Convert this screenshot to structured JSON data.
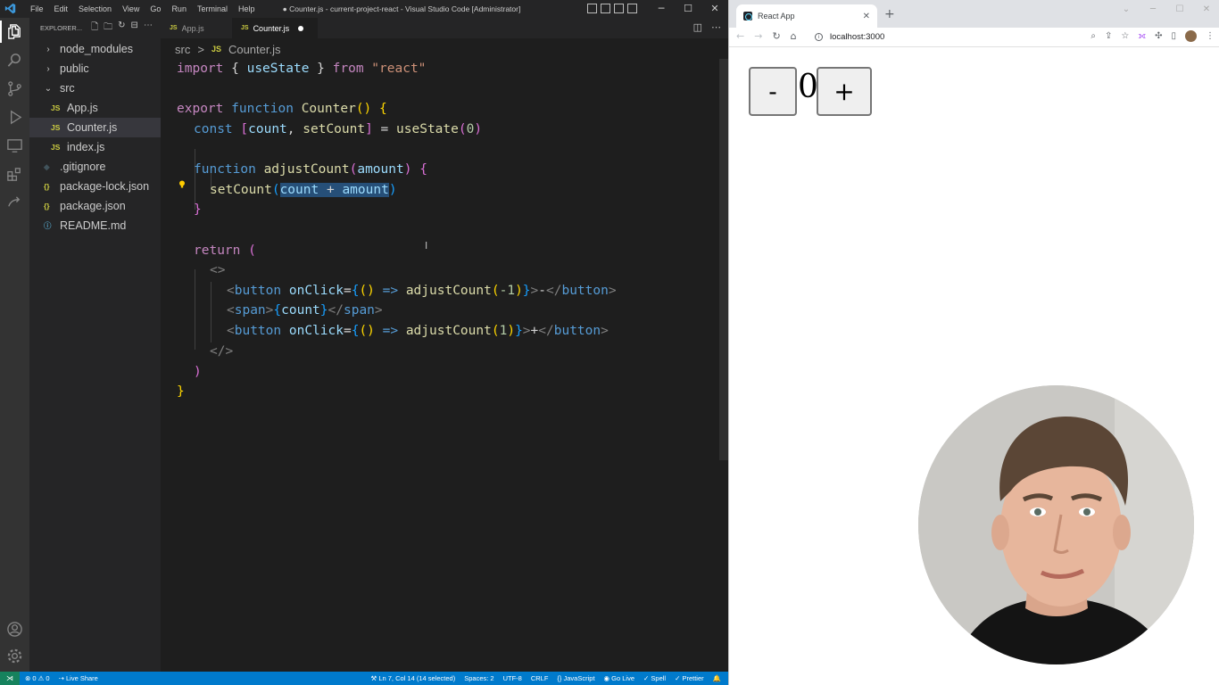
{
  "vscode": {
    "menu": [
      "File",
      "Edit",
      "Selection",
      "View",
      "Go",
      "Run",
      "Terminal",
      "Help"
    ],
    "window_title": "● Counter.js - current-project-react - Visual Studio Code [Administrator]",
    "explorer_label": "EXPLORER...",
    "tree": [
      {
        "label": "node_modules",
        "kind": "folder",
        "expanded": false
      },
      {
        "label": "public",
        "kind": "folder",
        "expanded": false
      },
      {
        "label": "src",
        "kind": "folder",
        "expanded": true
      },
      {
        "label": "App.js",
        "kind": "js",
        "icon": "JS"
      },
      {
        "label": "Counter.js",
        "kind": "js",
        "icon": "JS",
        "selected": true
      },
      {
        "label": "index.js",
        "kind": "js",
        "icon": "JS"
      },
      {
        "label": ".gitignore",
        "kind": "git",
        "icon": "◆"
      },
      {
        "label": "package-lock.json",
        "kind": "json",
        "icon": "{}"
      },
      {
        "label": "package.json",
        "kind": "json",
        "icon": "{}"
      },
      {
        "label": "README.md",
        "kind": "md",
        "icon": "ⓘ"
      }
    ],
    "tabs": [
      {
        "label": "App.js",
        "icon": "JS"
      },
      {
        "label": "Counter.js",
        "icon": "JS",
        "active": true,
        "modified": true
      }
    ],
    "breadcrumb": {
      "folder": "src",
      "sep": ">",
      "icon": "JS",
      "file": "Counter.js"
    },
    "code": {
      "l1": {
        "a": "import",
        "b": " { ",
        "c": "useState",
        "d": " } ",
        "e": "from",
        "f": " ",
        "g": "\"react\""
      },
      "l3": {
        "a": "export",
        "b": " ",
        "c": "function",
        "d": " ",
        "e": "Counter",
        "f": "() ",
        "g": "{"
      },
      "l4": {
        "a": "const",
        "b": " ",
        "c": "[",
        "d": "count",
        "e": ", ",
        "f": "setCount",
        "g": "]",
        "h": " = ",
        "i": "useState",
        "j": "(",
        "k": "0",
        "l": ")"
      },
      "l6": {
        "a": "function",
        "b": " ",
        "c": "adjustCount",
        "d": "(",
        "e": "amount",
        "f": ")",
        "g": " ",
        "h": "{"
      },
      "l7": {
        "a": "setCount",
        "b": "(",
        "c": "count",
        "d": " + ",
        "e": "amount",
        "f": ")"
      },
      "l8": {
        "a": "}"
      },
      "l10": {
        "a": "return",
        "b": " ",
        "c": "("
      },
      "l11": {
        "a": "<>"
      },
      "l12": {
        "a": "<",
        "b": "button",
        "c": " ",
        "d": "onClick",
        "e": "=",
        "f": "{",
        "g": "()",
        "h": " => ",
        "i": "adjustCount",
        "j": "(",
        "k": "-1",
        "l": ")",
        "m": "}",
        "n": ">",
        "o": "-",
        "p": "</",
        "q": "button",
        "r": ">"
      },
      "l13": {
        "a": "<",
        "b": "span",
        "c": ">",
        "d": "{",
        "e": "count",
        "f": "}",
        "g": "</",
        "h": "span",
        "i": ">"
      },
      "l14": {
        "a": "<",
        "b": "button",
        "c": " ",
        "d": "onClick",
        "e": "=",
        "f": "{",
        "g": "()",
        "h": " => ",
        "i": "adjustCount",
        "j": "(",
        "k": "1",
        "l": ")",
        "m": "}",
        "n": ">",
        "o": "+",
        "p": "</",
        "q": "button",
        "r": ">"
      },
      "l15": {
        "a": "</>"
      },
      "l16": {
        "a": ")"
      },
      "l17": {
        "a": "}"
      }
    },
    "status": {
      "remote": "⋊",
      "problems": "⊗ 0 ⚠ 0",
      "liveshare": "Live Share",
      "position": "Ln 7, Col 14 (14 selected)",
      "spaces": "Spaces: 2",
      "encoding": "UTF-8",
      "eol": "CRLF",
      "language": "{} JavaScript",
      "golive": "Go Live",
      "spell": "Spell",
      "prettier": "Prettier"
    }
  },
  "browser": {
    "tab_title": "React App",
    "url": "localhost:3000",
    "app": {
      "minus_label": "-",
      "count": "0",
      "plus_label": "+"
    }
  }
}
